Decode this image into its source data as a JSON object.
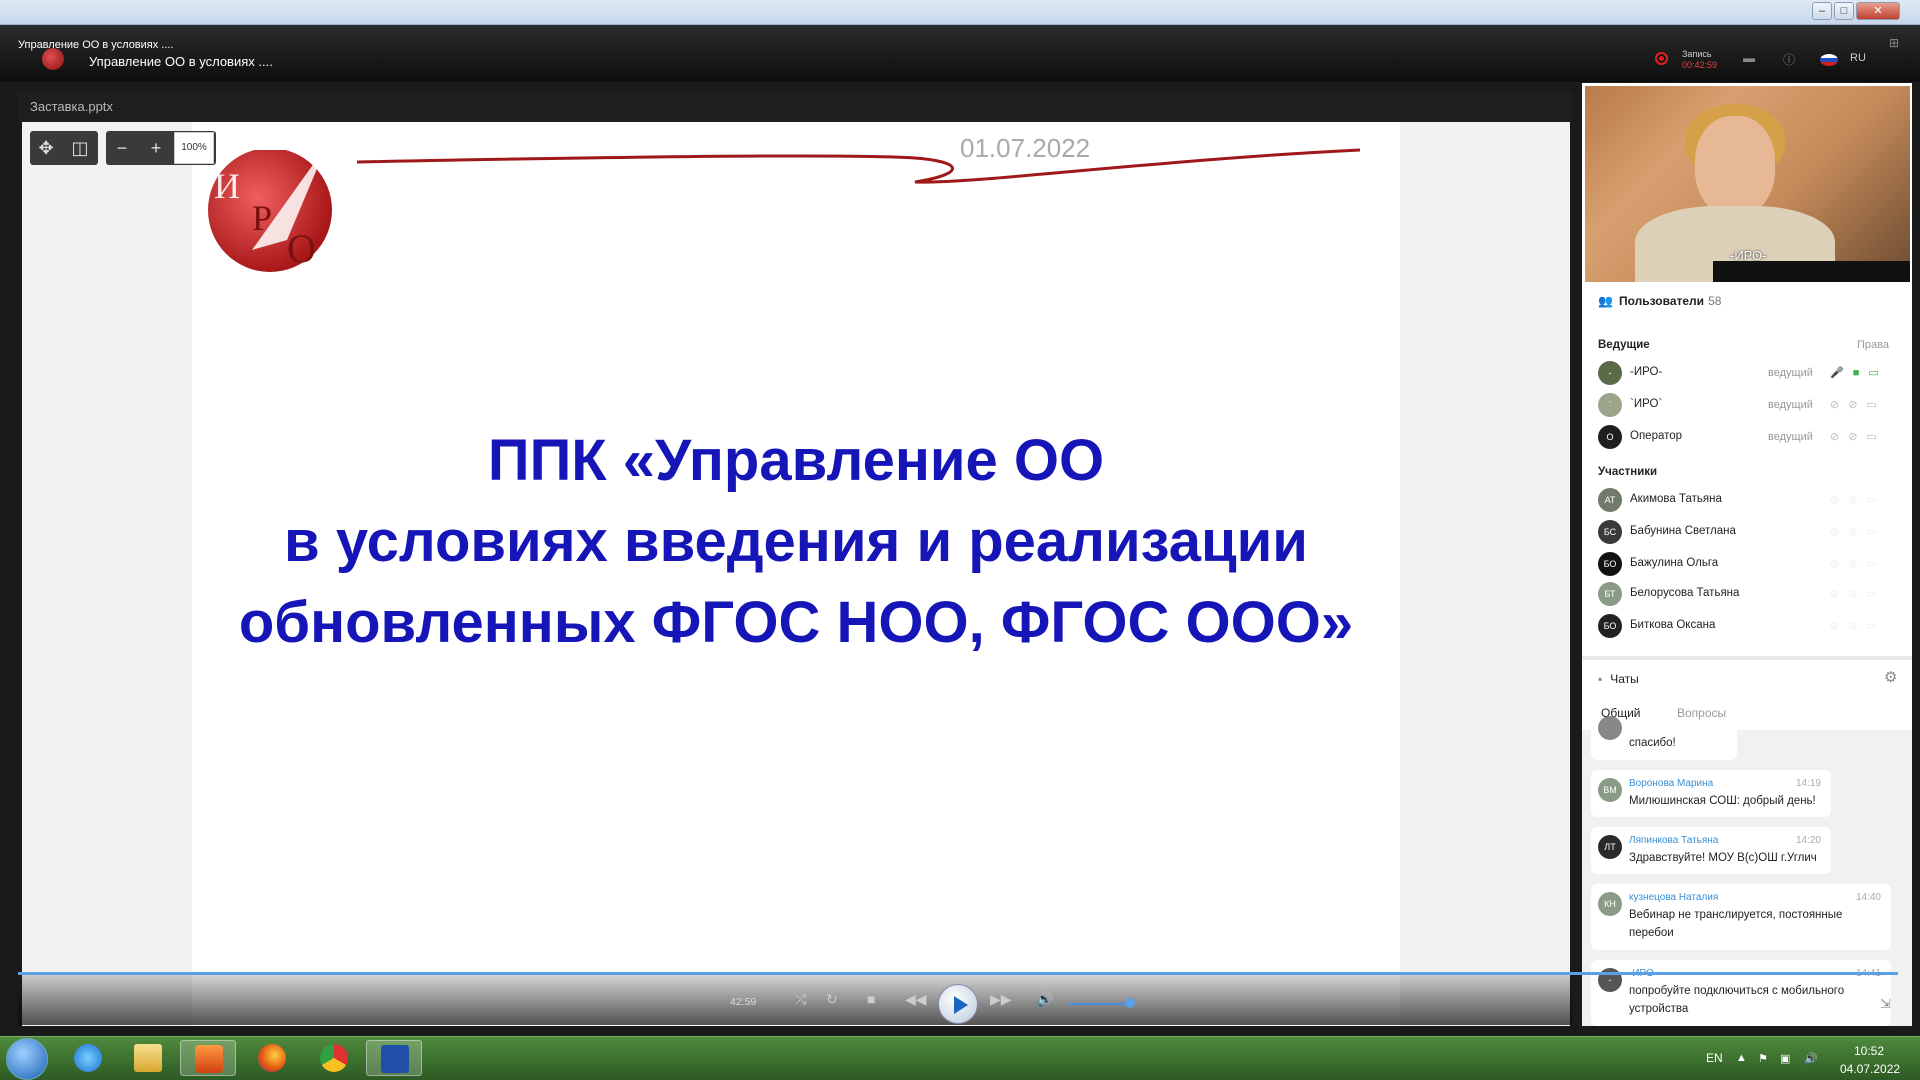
{
  "window": {
    "video_title": "Управление ОО в условиях ....",
    "app_title": "Управление ОО в условиях ...."
  },
  "toolbar": {
    "record_label": "Запись",
    "record_time": "00:42:59",
    "language": "RU"
  },
  "presentation": {
    "file_name": "Заставка.pptx",
    "zoom": "100%",
    "slide": {
      "date": "01.07.2022",
      "title_line1": "ППК «Управление ОО",
      "title_line2": "в условиях введения и реализации",
      "title_line3": "обновленных ФГОС НОО, ФГОС ООО»",
      "logo_letters": "ИРО"
    }
  },
  "webcam": {
    "label": "-ИРО-"
  },
  "users": {
    "header": "Пользователи",
    "count": "58",
    "hosts_header": "Ведущие",
    "rights_label": "Права",
    "hosts": [
      {
        "initials": "-",
        "name": "-ИРО-",
        "role": "ведущий",
        "color": "#5b6b4a"
      },
      {
        "initials": "`",
        "name": "`ИРО`",
        "role": "ведущий",
        "color": "#9aa58a"
      },
      {
        "initials": "О",
        "name": "Оператор",
        "role": "ведущий",
        "color": "#1f1f1f"
      }
    ],
    "participants_header": "Участники",
    "participants": [
      {
        "initials": "АТ",
        "name": "Акимова Татьяна",
        "color": "#6f7a68"
      },
      {
        "initials": "БС",
        "name": "Бабунина Светлана",
        "color": "#3a3a3a"
      },
      {
        "initials": "БО",
        "name": "Бажулина Ольга",
        "color": "#111111"
      },
      {
        "initials": "БТ",
        "name": "Белорусова Татьяна",
        "color": "#8a9c86"
      },
      {
        "initials": "БО",
        "name": "Биткова Оксана",
        "color": "#222222"
      }
    ]
  },
  "chat": {
    "header": "Чаты",
    "tabs": [
      "Общий",
      "Вопросы"
    ],
    "messages": [
      {
        "initials": "",
        "author": "",
        "time": "",
        "text": "спасибо!",
        "color": "#888888"
      },
      {
        "initials": "ВМ",
        "author": "Воронова Марина",
        "time": "14:19",
        "text": "Милюшинская СОШ: добрый день!",
        "color": "#8a9c86"
      },
      {
        "initials": "ЛТ",
        "author": "Ляпинкова Татьяна",
        "time": "14:20",
        "text": "Здравствуйте! МОУ В(с)ОШ г.Углич",
        "color": "#2a2a2a"
      },
      {
        "initials": "КН",
        "author": "кузнецова Наталия",
        "time": "14:40",
        "text": "Вебинар не транслируется, постоянные перебои",
        "color": "#8a9c86"
      },
      {
        "initials": "-",
        "author": "-ИРО-",
        "time": "14:41",
        "text": "попробуйте подключиться с мобильного устройства",
        "color": "#555555"
      }
    ]
  },
  "player": {
    "time": "42:59"
  },
  "taskbar": {
    "language": "EN",
    "time": "10:52",
    "date": "04.07.2022"
  },
  "colors": {
    "slide_title": "#1515b8",
    "accent_blue": "#3a8fd6",
    "record_red": "#e02020",
    "mic_on": "#3cb34a"
  }
}
